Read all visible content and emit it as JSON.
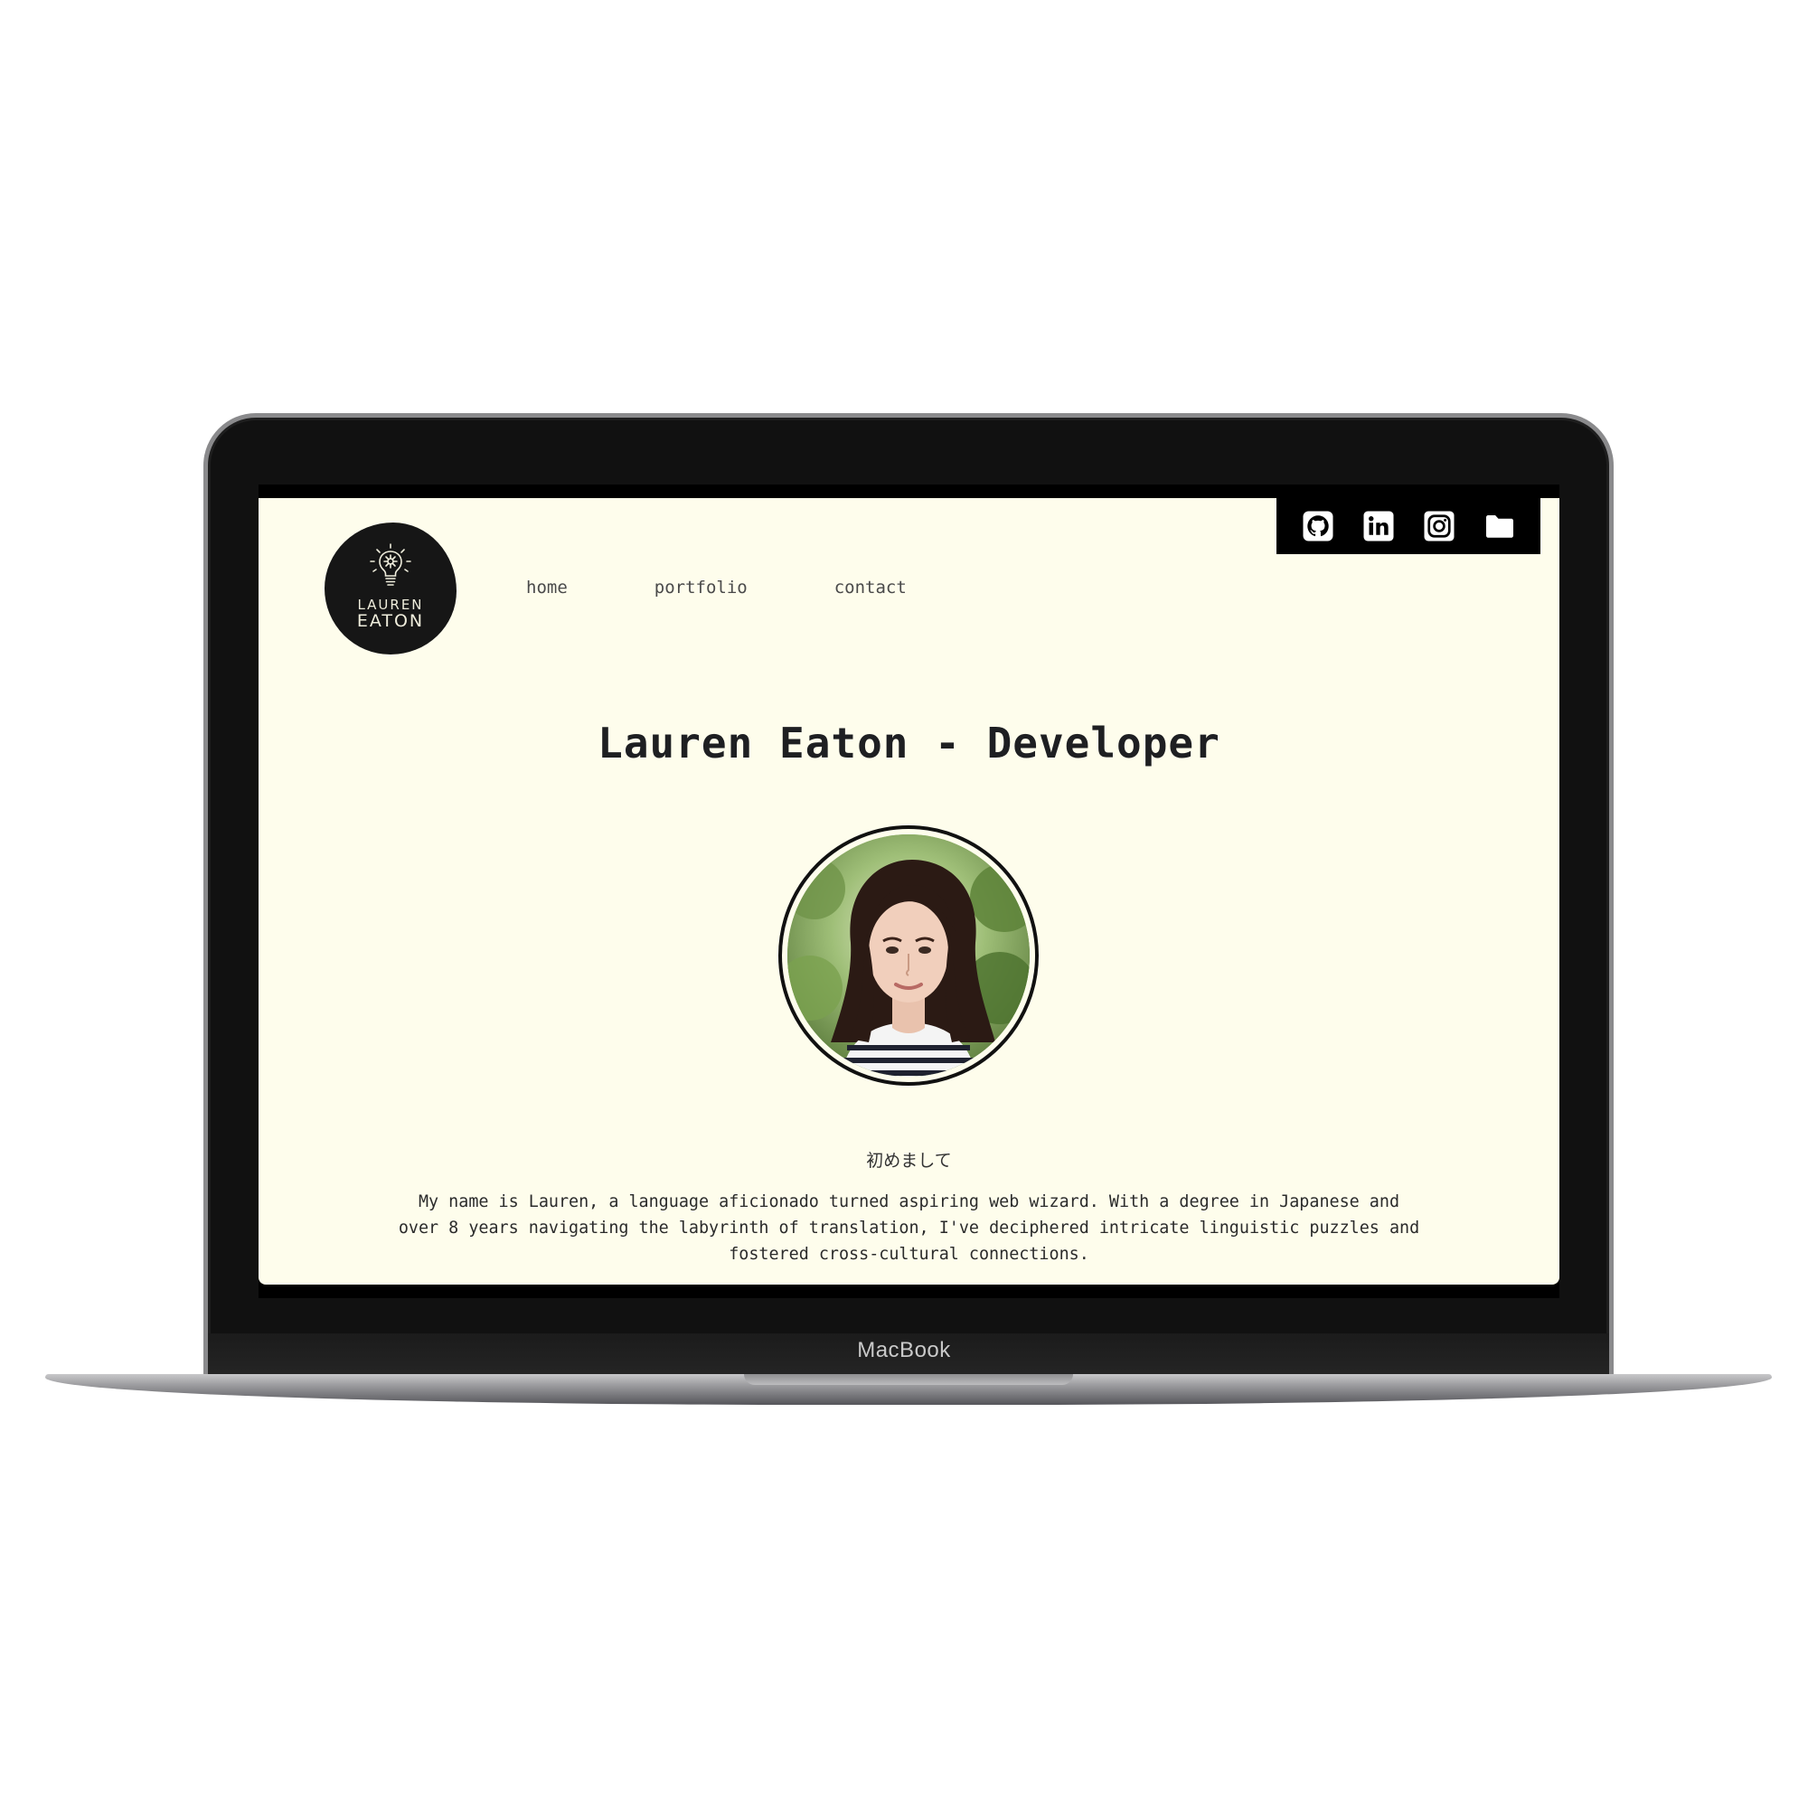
{
  "device": {
    "brand_label": "MacBook"
  },
  "site": {
    "logo": {
      "line1": "LAUREN",
      "line2": "EATON"
    },
    "social": [
      {
        "name": "github",
        "icon": "github-icon"
      },
      {
        "name": "linkedin",
        "icon": "linkedin-icon"
      },
      {
        "name": "instagram",
        "icon": "instagram-icon"
      },
      {
        "name": "folder",
        "icon": "folder-icon"
      }
    ],
    "nav": {
      "home": "home",
      "portfolio": "portfolio",
      "contact": "contact"
    },
    "headline": "Lauren Eaton - Developer",
    "greeting": "初めまして",
    "bio_paragraph_1": "My name is Lauren, a language aficionado turned aspiring web wizard. With a degree in Japanese and over 8 years navigating the labyrinth of translation, I've deciphered intricate linguistic puzzles and fostered cross-cultural connections.",
    "colors": {
      "page_background": "#fefdec",
      "text": "#2b2b2b",
      "accent": "#000000"
    }
  }
}
